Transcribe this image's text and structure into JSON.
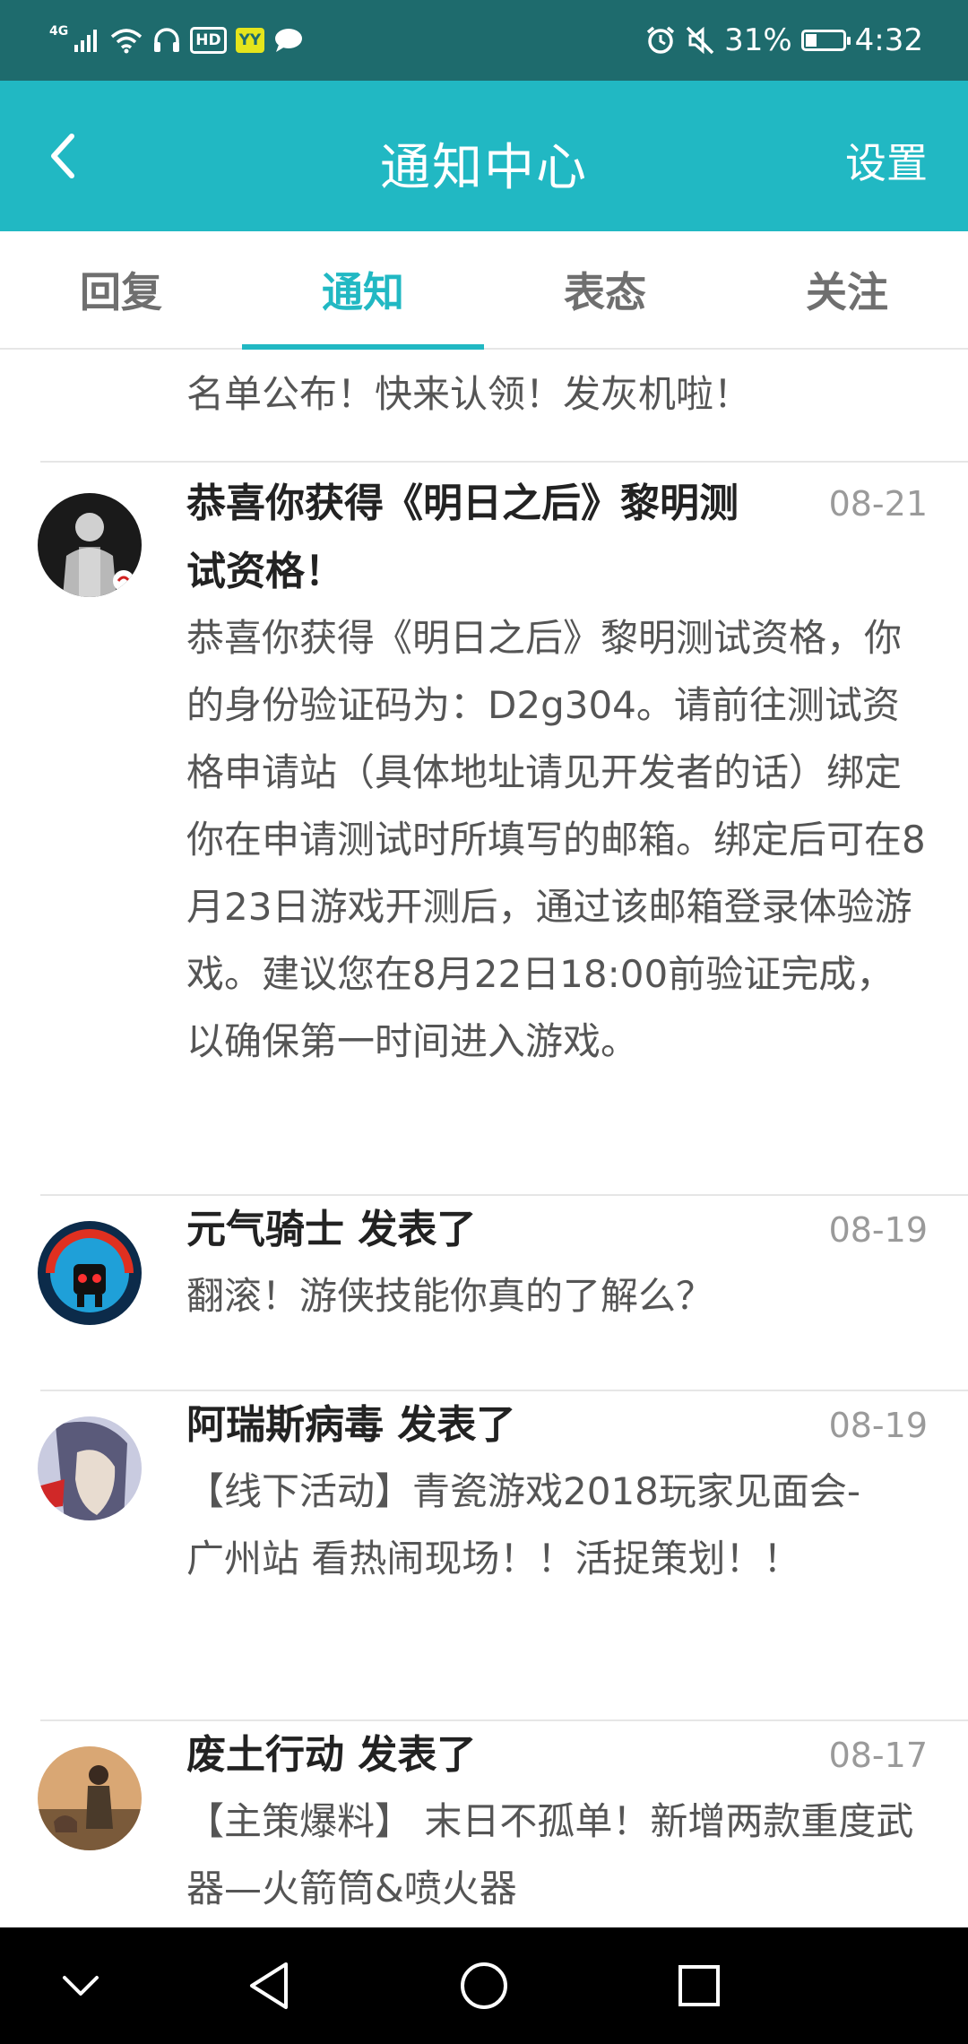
{
  "status_bar": {
    "network": "4G",
    "hd": "HD",
    "yy": "YY",
    "battery_pct": "31%",
    "battery_level": 0.31,
    "time": "4:32"
  },
  "header": {
    "title": "通知中心",
    "settings_label": "设置",
    "back_icon": "chevron-left-icon"
  },
  "tabs": [
    {
      "label": "回复",
      "active": false
    },
    {
      "label": "通知",
      "active": true
    },
    {
      "label": "表态",
      "active": false
    },
    {
      "label": "关注",
      "active": false
    }
  ],
  "notifications": {
    "partial_top": {
      "body": "名单公布！快来认领！发灰机啦！"
    },
    "items": [
      {
        "title": "恭喜你获得《明日之后》黎明测试资格！",
        "title_line1": "恭喜你获得《明日之后》黎明测",
        "title_line2": "试资格！",
        "date": "08-21",
        "body": "恭喜你获得《明日之后》黎明测试资格，你的身份验证码为：D2g304。请前往测试资格申请站（具体地址请见开发者的话）绑定你在申请测试时所填写的邮箱。绑定后可在8月23日游戏开测后，通过该邮箱登录体验游戏。建议您在8月22日18:00前验证完成，以确保第一时间进入游戏。"
      },
      {
        "title": "元气骑士 发表了",
        "date": "08-19",
        "body": "翻滚！游侠技能你真的了解么？"
      },
      {
        "title": "阿瑞斯病毒 发表了",
        "date": "08-19",
        "body": "【线下活动】青瓷游戏2018玩家见面会-广州站 看热闹现场！！活捉策划！！"
      },
      {
        "title": "废土行动 发表了",
        "date": "08-17",
        "body": "【主策爆料】 末日不孤单！新增两款重度武器—火箭筒&喷火器"
      }
    ]
  },
  "nav_bar": {
    "icons": [
      "chevron-down-icon",
      "back-triangle-icon",
      "home-circle-icon",
      "recents-square-icon"
    ]
  },
  "colors": {
    "status_bar": "#1e6b6d",
    "accent": "#21b8c3",
    "nav_bar": "#000000"
  }
}
